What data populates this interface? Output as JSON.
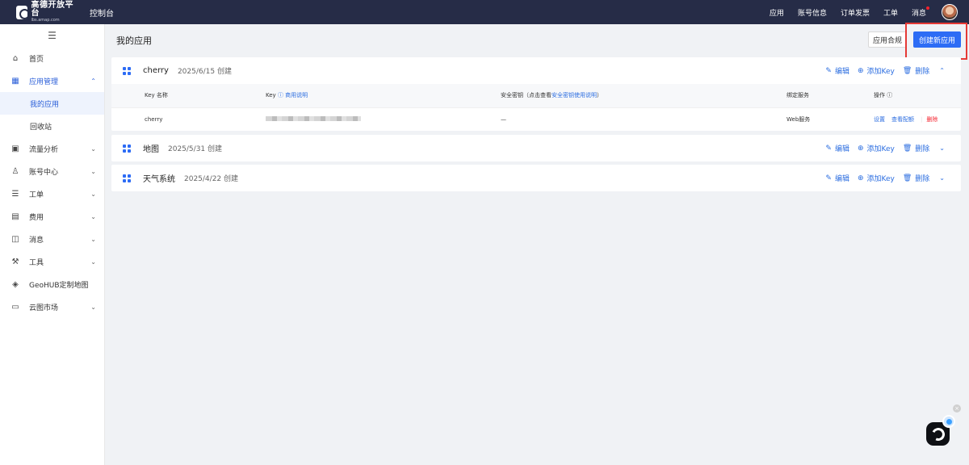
{
  "topbar": {
    "logo_title": "高德开放平台",
    "logo_sub": "lbs.amap.com",
    "console": "控制台",
    "nav": [
      "应用",
      "账号信息",
      "订单发票",
      "工单",
      "消息"
    ]
  },
  "sidebar": {
    "collapse_icon": "☰",
    "items": [
      {
        "label": "首页",
        "icon": "⌂"
      },
      {
        "label": "应用管理",
        "icon": "▦",
        "chev": "⌃",
        "children": [
          {
            "label": "我的应用"
          },
          {
            "label": "回收站"
          }
        ]
      },
      {
        "label": "流量分析",
        "icon": "▣",
        "chev": "⌄"
      },
      {
        "label": "账号中心",
        "icon": "♙",
        "chev": "⌄"
      },
      {
        "label": "工单",
        "icon": "☰",
        "chev": "⌄"
      },
      {
        "label": "费用",
        "icon": "▤",
        "chev": "⌄"
      },
      {
        "label": "消息",
        "icon": "◫",
        "chev": "⌄"
      },
      {
        "label": "工具",
        "icon": "⚒",
        "chev": "⌄"
      },
      {
        "label": "GeoHUB定制地图",
        "icon": "◈"
      },
      {
        "label": "云图市场",
        "icon": "▭",
        "chev": "⌄"
      }
    ]
  },
  "main": {
    "title": "我的应用",
    "compliance_button": "应用合规",
    "create_button": "创建新应用",
    "actions": {
      "edit": "编辑",
      "add_key": "添加Key",
      "delete": "删除"
    },
    "action_icons": {
      "edit": "✎",
      "add_key": "⊕",
      "delete": "🗑"
    },
    "apps": [
      {
        "name": "cherry",
        "date": "2025/6/15 创建",
        "toggle": "⌃"
      },
      {
        "name": "地图",
        "date": "2025/5/31 创建",
        "toggle": "⌄"
      },
      {
        "name": "天气系统",
        "date": "2025/4/22 创建",
        "toggle": "⌄"
      }
    ],
    "key_table": {
      "headers": {
        "key_name": "Key 名称",
        "key": "Key",
        "key_help": "ⓘ 商用说明",
        "secret_prefix": "安全密钥（点击查看",
        "secret_link": "安全密钥使用说明",
        "secret_suffix": "）",
        "service": "绑定服务",
        "ops": "操作 ⓘ"
      },
      "row": {
        "name": "cherry",
        "secret": "—",
        "service": "Web服务",
        "ops": [
          "设置",
          "查看配额",
          "删除"
        ]
      }
    }
  },
  "floating": {
    "close": "×"
  }
}
